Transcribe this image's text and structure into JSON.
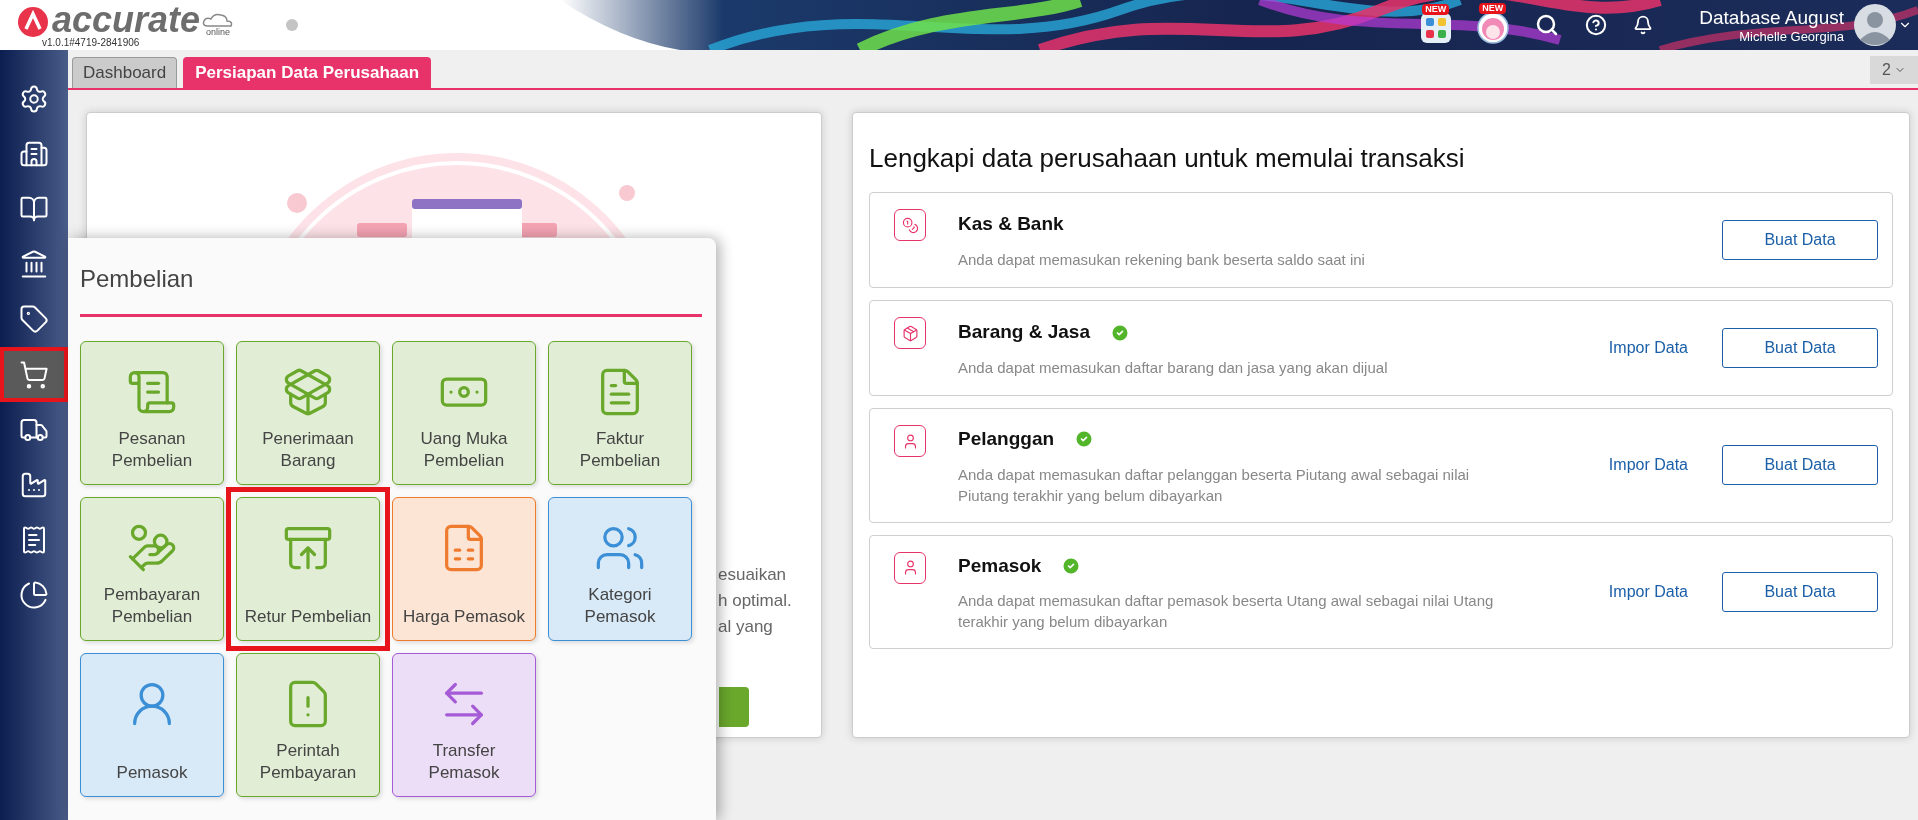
{
  "header": {
    "logo": "accurate",
    "logo_sub": "online",
    "version": "v1.0.1#4719-2841906",
    "badges": [
      {
        "text": "NEW"
      },
      {
        "text": "NEW"
      }
    ],
    "database": "Database August",
    "user": "Michelle Georgina"
  },
  "tabs": [
    {
      "label": "Dashboard",
      "selected": false
    },
    {
      "label": "Persiapan Data Perusahaan",
      "selected": true
    }
  ],
  "tab_count": "2",
  "sidebar": {
    "items": [
      {
        "kind": "settings",
        "selected": false
      },
      {
        "kind": "building",
        "selected": false
      },
      {
        "kind": "book",
        "selected": false
      },
      {
        "kind": "bank",
        "selected": false
      },
      {
        "kind": "tag",
        "selected": false
      },
      {
        "kind": "cart",
        "selected": true
      },
      {
        "kind": "truck",
        "selected": false
      },
      {
        "kind": "factory",
        "selected": false
      },
      {
        "kind": "tax",
        "selected": false
      },
      {
        "kind": "chart",
        "selected": false
      }
    ]
  },
  "welcome_card": {
    "text_lines": [
      "esuaikan",
      "h optimal.",
      "al yang"
    ]
  },
  "menu": {
    "title": "Pembelian",
    "tiles": [
      {
        "lines": [
          "Pesanan",
          "Pembelian"
        ],
        "kind": "order",
        "color": "#6aa82c",
        "selected": false
      },
      {
        "lines": [
          "Penerimaan",
          "Barang"
        ],
        "kind": "receive",
        "color": "#6aa82c",
        "selected": false
      },
      {
        "lines": [
          "Uang Muka",
          "Pembelian"
        ],
        "kind": "money",
        "color": "#6aa82c",
        "selected": false
      },
      {
        "lines": [
          "Faktur",
          "Pembelian"
        ],
        "kind": "invoice",
        "color": "#6aa82c",
        "selected": false
      },
      {
        "lines": [
          "Pembayaran",
          "Pembelian"
        ],
        "kind": "payment",
        "color": "#6aa82c",
        "selected": false
      },
      {
        "lines": [
          "Retur Pembelian"
        ],
        "kind": "return",
        "color": "#6aa82c",
        "selected": true
      },
      {
        "lines": [
          "Harga Pemasok"
        ],
        "kind": "price",
        "color": "#ee7b2e",
        "selected": false
      },
      {
        "lines": [
          "Kategori",
          "Pemasok"
        ],
        "kind": "category",
        "color": "#3a8fd6",
        "selected": false
      },
      {
        "lines": [
          "Pemasok"
        ],
        "kind": "supplier",
        "color": "#3a8fd6",
        "selected": false
      },
      {
        "lines": [
          "Perintah",
          "Pembayaran"
        ],
        "kind": "order-pay",
        "color": "#6aa82c",
        "selected": false
      },
      {
        "lines": [
          "Transfer",
          "Pemasok"
        ],
        "kind": "transfer",
        "color": "#a55ad6",
        "selected": false
      }
    ]
  },
  "setup": {
    "title": "Lengkapi data perusahaan untuk memulai transaksi",
    "items": [
      {
        "kind": "cash",
        "title": "Kas & Bank",
        "done": false,
        "description": "Anda dapat memasukan rekening bank beserta saldo saat ini",
        "button": "Buat Data"
      },
      {
        "kind": "goods",
        "title": "Barang & Jasa",
        "done": true,
        "description": "Anda dapat memasukan daftar barang dan jasa yang akan dijual",
        "import": "Impor Data",
        "button": "Buat Data"
      },
      {
        "kind": "customer",
        "title": "Pelanggan",
        "done": true,
        "description": "Anda dapat memasukan daftar pelanggan beserta Piutang awal sebagai nilai Piutang terakhir yang belum dibayarkan",
        "import": "Impor Data",
        "button": "Buat Data"
      },
      {
        "kind": "supplier",
        "title": "Pemasok",
        "done": true,
        "description": "Anda dapat memasukan daftar pemasok beserta Utang awal sebagai nilai Utang terakhir yang belum dibayarkan",
        "import": "Impor Data",
        "button": "Buat Data"
      }
    ]
  }
}
